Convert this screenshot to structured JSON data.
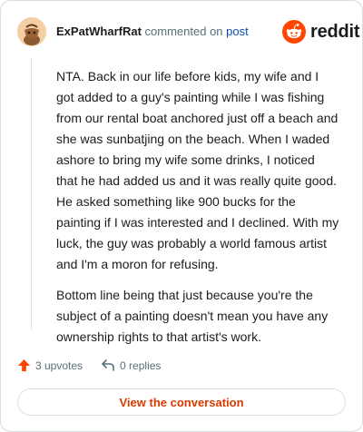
{
  "comment": {
    "author": "ExPatWharfRat",
    "action": "commented on",
    "target_link": "post",
    "paragraphs": [
      "NTA. Back in our life before kids, my wife and I got added to a guy's painting while I was fishing from our rental boat anchored just off a beach and she was sunbatjing on the beach. When I waded ashore to bring my wife some drinks, I noticed that he had added us and it was really quite good. He asked something like 900 bucks for the painting if I was interested and I declined. With my luck, the guy was probably a world famous artist and I'm a moron for refusing.",
      "Bottom line being that just because you're the subject of a painting doesn't mean you have any ownership rights to that artist's work."
    ]
  },
  "brand": {
    "name": "reddit",
    "accent": "#ff4500"
  },
  "actions": {
    "upvotes_label": "3 upvotes",
    "replies_label": "0 replies"
  },
  "cta": {
    "label": "View the conversation",
    "color": "#d93a00"
  },
  "icons": {
    "avatar": "user-avatar",
    "logo": "reddit-snoo-icon",
    "upvote": "upvote-arrow-icon",
    "reply": "reply-arrow-icon"
  }
}
